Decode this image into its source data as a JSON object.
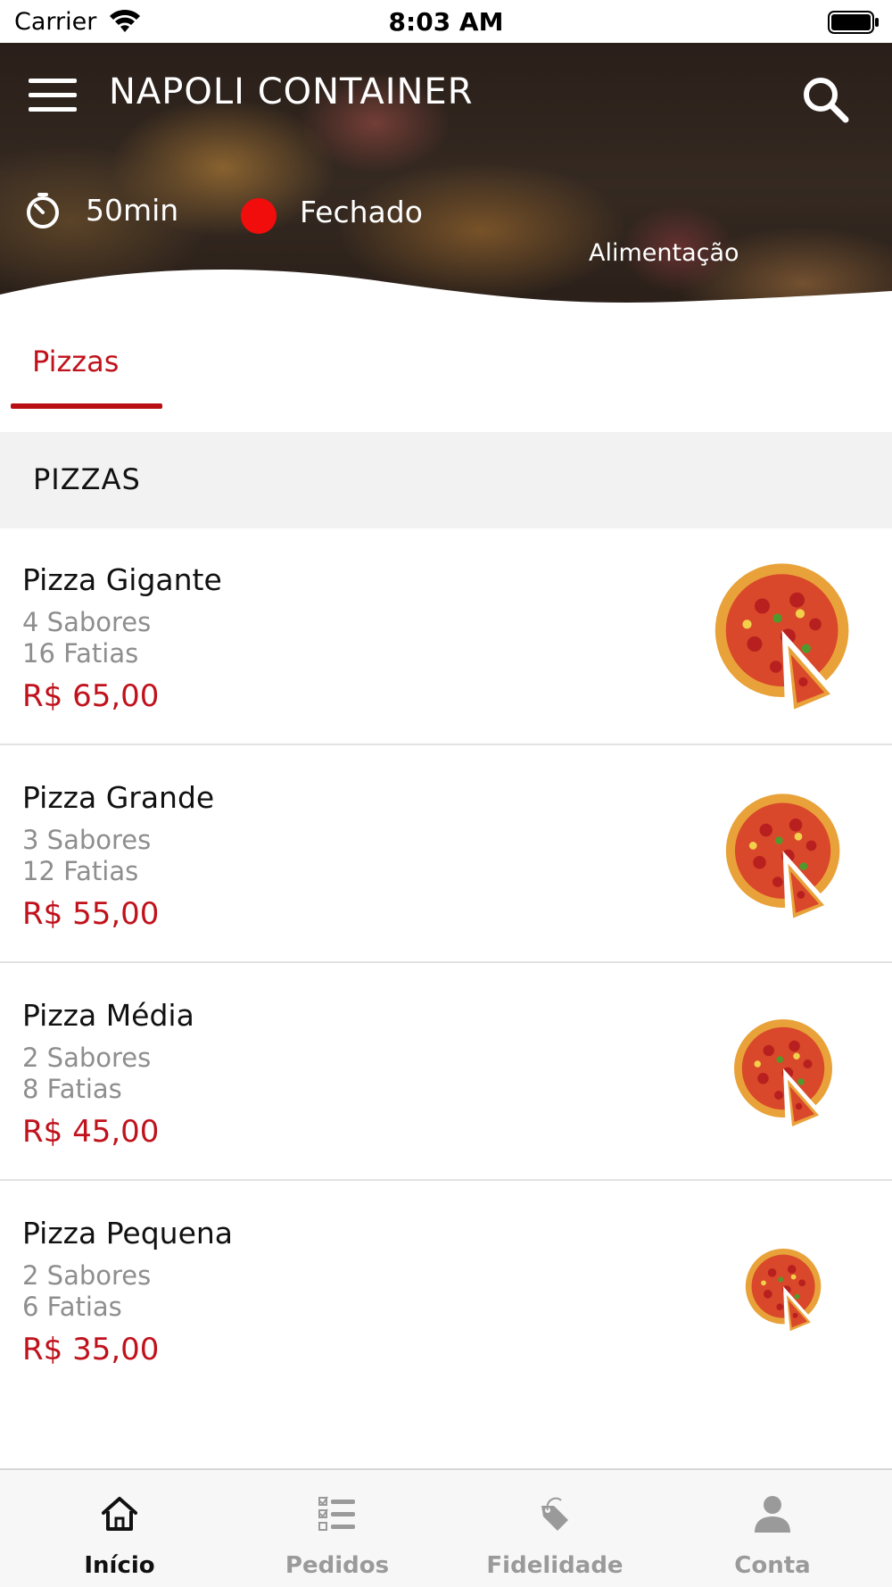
{
  "status_bar": {
    "carrier": "Carrier",
    "time": "8:03 AM"
  },
  "header": {
    "title": "NAPOLI CONTAINER",
    "eta": "50min",
    "store_status": "Fechado",
    "status_color": "#f20d0d",
    "category": "Alimentação"
  },
  "tabs": [
    {
      "label": "Pizzas",
      "active": true
    }
  ],
  "section": {
    "title": "PIZZAS"
  },
  "products": [
    {
      "name": "Pizza Gigante",
      "flavors": "4 Sabores",
      "slices": "16 Fatias",
      "price": "R$ 65,00",
      "image_icon": "pizza-icon"
    },
    {
      "name": "Pizza Grande",
      "flavors": "3 Sabores",
      "slices": "12 Fatias",
      "price": "R$ 55,00",
      "image_icon": "pizza-icon"
    },
    {
      "name": "Pizza Média",
      "flavors": "2 Sabores",
      "slices": "8 Fatias",
      "price": "R$ 45,00",
      "image_icon": "pizza-icon"
    },
    {
      "name": "Pizza Pequena",
      "flavors": "2 Sabores",
      "slices": "6 Fatias",
      "price": "R$ 35,00",
      "image_icon": "pizza-icon"
    }
  ],
  "bottom_nav": [
    {
      "label": "Início",
      "icon": "home-icon",
      "active": true
    },
    {
      "label": "Pedidos",
      "icon": "order-list-icon",
      "active": false
    },
    {
      "label": "Fidelidade",
      "icon": "tag-icon",
      "active": false
    },
    {
      "label": "Conta",
      "icon": "user-icon",
      "active": false
    }
  ],
  "colors": {
    "accent": "#c0121c",
    "inactive": "#9a9a9a",
    "section_bg": "#f2f2f2"
  }
}
